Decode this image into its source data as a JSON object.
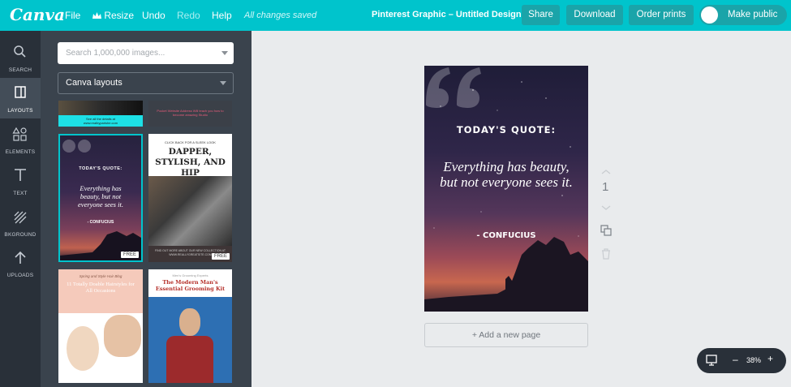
{
  "app": {
    "logo": "Canva"
  },
  "menu": {
    "file": "File",
    "resize": "Resize",
    "undo": "Undo",
    "redo": "Redo",
    "help": "Help",
    "saved_status": "All changes saved"
  },
  "document": {
    "title": "Pinterest Graphic – Untitled Design"
  },
  "toolbar": {
    "share": "Share",
    "download": "Download",
    "order_prints": "Order prints",
    "make_public": "Make public"
  },
  "sidenav": [
    {
      "label": "SEARCH",
      "icon": "search-icon"
    },
    {
      "label": "LAYOUTS",
      "icon": "layouts-icon"
    },
    {
      "label": "ELEMENTS",
      "icon": "elements-icon"
    },
    {
      "label": "TEXT",
      "icon": "text-icon"
    },
    {
      "label": "BKGROUND",
      "icon": "background-icon"
    },
    {
      "label": "UPLOADS",
      "icon": "upload-icon"
    }
  ],
  "panel": {
    "search_placeholder": "Search 1,000,000 images...",
    "layout_dropdown": "Canva layouts",
    "thumbnails": [
      {
        "caption": "See all the details at www.realbyparishe.com"
      },
      {
        "caption": "Pocket Website Address Will teach you how to become amazing Studio"
      },
      {
        "heading": "TODAY'S QUOTE:",
        "body": "Everything has beauty, but not everyone sees it.",
        "author": "- CONFUCIUS",
        "badge": "FREE"
      },
      {
        "top": "CLICK BACK FOR A SLEEK LOOK",
        "heading": "DAPPER, STYLISH, AND HIP",
        "footer": "FIND OUT MORE ABOUT OUR NEW COLLECTION AT WWW.REALLYGREATSITE.COM",
        "badge": "FREE"
      },
      {
        "top": "Spring and Style Hair Blog",
        "heading": "11 Totally Doable Hairstyles for All Occasions"
      },
      {
        "top": "Men's Grooming Experts",
        "heading": "The Modern Man's Essential Grooming Kit"
      }
    ]
  },
  "design": {
    "heading": "TODAY'S QUOTE:",
    "body": "Everything has beauty, but not everyone sees it.",
    "author": "- CONFUCIUS"
  },
  "canvas": {
    "page_number": "1",
    "add_page": "+ Add a new page",
    "zoom": "38%",
    "zoom_minus": "–",
    "zoom_plus": "+"
  },
  "colors": {
    "accent": "#00c4cc",
    "nav": "#293039",
    "panel": "#3a434d",
    "canvas_bg": "#e9ebed"
  }
}
